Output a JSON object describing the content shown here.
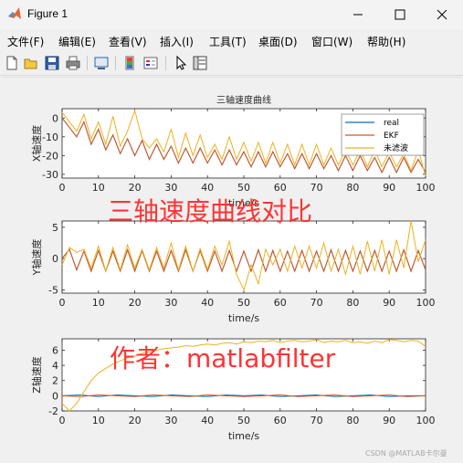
{
  "window": {
    "title": "Figure 1",
    "minimize_symbol": "—",
    "maximize_symbol": "☐",
    "close_symbol": "✕"
  },
  "menu": [
    "文件(F)",
    "编辑(E)",
    "查看(V)",
    "插入(I)",
    "工具(T)",
    "桌面(D)",
    "窗口(W)",
    "帮助(H)"
  ],
  "toolbar": {
    "icons": [
      "new-file-icon",
      "open-folder-icon",
      "save-icon",
      "print-icon",
      "link-figure-icon",
      "colorbar-icon",
      "legend-icon",
      "pointer-icon",
      "property-inspector-icon"
    ]
  },
  "overlays": {
    "comparison_caption": "三轴速度曲线对比",
    "author_caption": "作者：matlabfilter",
    "color": "#ff3333",
    "watermark": "CSDN @MATLAB卡尔曼"
  },
  "chart_data": [
    {
      "type": "line",
      "title": "三轴速度曲线",
      "xlabel": "time/s",
      "ylabel": "X轴速度",
      "xlim": [
        0,
        100
      ],
      "ylim": [
        -32,
        5
      ],
      "xticks": [
        "0",
        "10",
        "20",
        "30",
        "40",
        "50",
        "60",
        "70",
        "80",
        "90",
        "100"
      ],
      "yticks": [
        "0",
        "-10",
        "-20",
        "-30"
      ],
      "legend": {
        "placement": "top-right",
        "entries": [
          "real",
          "EKF",
          "未滤波"
        ]
      },
      "series": [
        {
          "name": "real",
          "color": "#0072bd",
          "x": [
            0,
            2,
            4,
            6,
            8,
            10,
            12,
            14,
            16,
            18,
            20,
            22,
            24,
            26,
            28,
            30,
            32,
            34,
            36,
            38,
            40,
            42,
            44,
            46,
            48,
            50,
            52,
            54,
            56,
            58,
            60,
            62,
            64,
            66,
            68,
            70,
            72,
            74,
            76,
            78,
            80,
            82,
            84,
            86,
            88,
            90,
            92,
            94,
            96,
            98,
            100
          ],
          "y": [
            0,
            -5,
            -10,
            -2,
            -14,
            -6,
            -17,
            -9,
            -19,
            -11,
            -20,
            -12,
            -22,
            -14,
            -22,
            -15,
            -24,
            -16,
            -24,
            -16,
            -24,
            -17,
            -25,
            -17,
            -25,
            -18,
            -26,
            -18,
            -26,
            -18,
            -26,
            -19,
            -27,
            -19,
            -27,
            -19,
            -27,
            -20,
            -28,
            -20,
            -28,
            -20,
            -28,
            -21,
            -29,
            -21,
            -29,
            -21,
            -29,
            -22,
            -29
          ]
        },
        {
          "name": "EKF",
          "color": "#d95319",
          "x": [
            0,
            2,
            4,
            6,
            8,
            10,
            12,
            14,
            16,
            18,
            20,
            22,
            24,
            26,
            28,
            30,
            32,
            34,
            36,
            38,
            40,
            42,
            44,
            46,
            48,
            50,
            52,
            54,
            56,
            58,
            60,
            62,
            64,
            66,
            68,
            70,
            72,
            74,
            76,
            78,
            80,
            82,
            84,
            86,
            88,
            90,
            92,
            94,
            96,
            98,
            100
          ],
          "y": [
            0,
            -5,
            -10,
            -2,
            -14,
            -6,
            -17,
            -9,
            -19,
            -11,
            -20,
            -12,
            -22,
            -14,
            -22,
            -15,
            -24,
            -16,
            -24,
            -16,
            -24,
            -17,
            -25,
            -17,
            -25,
            -18,
            -26,
            -18,
            -26,
            -18,
            -26,
            -19,
            -27,
            -19,
            -27,
            -19,
            -27,
            -20,
            -28,
            -20,
            -28,
            -20,
            -28,
            -21,
            -29,
            -21,
            -29,
            -21,
            -29,
            -22,
            -29
          ]
        },
        {
          "name": "未滤波",
          "color": "#edb120",
          "x": [
            0,
            2,
            4,
            6,
            8,
            10,
            12,
            14,
            16,
            18,
            20,
            22,
            24,
            26,
            28,
            30,
            32,
            34,
            36,
            38,
            40,
            42,
            44,
            46,
            48,
            50,
            52,
            54,
            56,
            58,
            60,
            62,
            64,
            66,
            68,
            70,
            72,
            74,
            76,
            78,
            80,
            82,
            84,
            86,
            88,
            90,
            92,
            94,
            96,
            98,
            100
          ],
          "y": [
            3,
            -2,
            -7,
            2,
            -11,
            -2,
            -14,
            1,
            -15,
            -7,
            4,
            -11,
            -16,
            -11,
            -18,
            -6,
            -21,
            -8,
            -20,
            -9,
            -21,
            -14,
            -22,
            -10,
            -22,
            -13,
            -23,
            -13,
            -24,
            -13,
            -24,
            -14,
            -25,
            -14,
            -25,
            -14,
            -25,
            -16,
            -25,
            -17,
            -25,
            -17,
            -26,
            -17,
            -26,
            -18,
            -26,
            -19,
            -28,
            -17,
            -31
          ]
        }
      ]
    },
    {
      "type": "line",
      "title": "",
      "xlabel": "time/s",
      "ylabel": "Y轴速度",
      "xlim": [
        0,
        100
      ],
      "ylim": [
        -5.5,
        6
      ],
      "xticks": [
        "0",
        "10",
        "20",
        "30",
        "40",
        "50",
        "60",
        "70",
        "80",
        "90",
        "100"
      ],
      "yticks": [
        "5",
        "0",
        "-5"
      ],
      "series": [
        {
          "name": "real",
          "color": "#0072bd",
          "x": [
            0,
            2,
            4,
            6,
            8,
            10,
            12,
            14,
            16,
            18,
            20,
            22,
            24,
            26,
            28,
            30,
            32,
            34,
            36,
            38,
            40,
            42,
            44,
            46,
            48,
            50,
            52,
            54,
            56,
            58,
            60,
            62,
            64,
            66,
            68,
            70,
            72,
            74,
            76,
            78,
            80,
            82,
            84,
            86,
            88,
            90,
            92,
            94,
            96,
            98,
            100
          ],
          "y": [
            0,
            1.5,
            -1.8,
            1.2,
            -2,
            1.3,
            -2,
            1.2,
            -2,
            1.4,
            -2,
            1.3,
            -2,
            1.2,
            -2,
            1.3,
            -2,
            1.4,
            -2,
            1.3,
            -2,
            1.2,
            -2,
            1.3,
            -2,
            1.2,
            -2,
            1.4,
            -2,
            1.3,
            -2,
            1.2,
            -2,
            1.3,
            -2,
            1.2,
            -2,
            1.4,
            -2,
            1.3,
            -2,
            1.2,
            -2,
            1.3,
            -2,
            1.2,
            -2,
            1.4,
            -2,
            1.3,
            -1.8
          ]
        },
        {
          "name": "EKF",
          "color": "#d95319",
          "x": [
            0,
            2,
            4,
            6,
            8,
            10,
            12,
            14,
            16,
            18,
            20,
            22,
            24,
            26,
            28,
            30,
            32,
            34,
            36,
            38,
            40,
            42,
            44,
            46,
            48,
            50,
            52,
            54,
            56,
            58,
            60,
            62,
            64,
            66,
            68,
            70,
            72,
            74,
            76,
            78,
            80,
            82,
            84,
            86,
            88,
            90,
            92,
            94,
            96,
            98,
            100
          ],
          "y": [
            0,
            1.5,
            -1.8,
            1.2,
            -2,
            1.3,
            -2,
            1.2,
            -2,
            1.4,
            -2,
            1.3,
            -2,
            1.2,
            -2,
            1.3,
            -2,
            1.4,
            -2,
            1.3,
            -2,
            1.2,
            -2,
            1.3,
            -2,
            1.2,
            -2,
            1.4,
            -2,
            1.3,
            -2,
            1.2,
            -2,
            1.3,
            -2,
            1.2,
            -2,
            1.4,
            -2,
            1.3,
            -2,
            1.2,
            -2,
            1.3,
            -2,
            1.2,
            -2,
            1.4,
            -2,
            1.3,
            -1.8
          ]
        },
        {
          "name": "未滤波",
          "color": "#edb120",
          "x": [
            0,
            2,
            4,
            6,
            8,
            10,
            12,
            14,
            16,
            18,
            20,
            22,
            24,
            26,
            28,
            30,
            32,
            34,
            36,
            38,
            40,
            42,
            44,
            46,
            48,
            50,
            52,
            54,
            56,
            58,
            60,
            62,
            64,
            66,
            68,
            70,
            72,
            74,
            76,
            78,
            80,
            82,
            84,
            86,
            88,
            90,
            92,
            94,
            96,
            98,
            100
          ],
          "y": [
            -1,
            1.8,
            1,
            1.5,
            -1.5,
            2,
            -2,
            1.8,
            -1.8,
            2.2,
            -1.5,
            1.5,
            -1.8,
            1.8,
            -1.5,
            2.5,
            -1.8,
            2,
            -2,
            1.6,
            -1.7,
            2,
            -1,
            2.8,
            -2.5,
            -5,
            -1,
            -4,
            1.5,
            -1,
            1.5,
            -2,
            2,
            -1.5,
            2,
            -1.5,
            2.5,
            -2,
            1.5,
            -2.5,
            2,
            -2.5,
            2.8,
            -2,
            3,
            -2.5,
            3,
            -1.5,
            6,
            -0.5,
            3
          ]
        }
      ]
    },
    {
      "type": "line",
      "title": "",
      "xlabel": "time/s",
      "ylabel": "Z轴速度",
      "xlim": [
        0,
        100
      ],
      "ylim": [
        -2,
        7.5
      ],
      "xticks": [
        "0",
        "10",
        "20",
        "30",
        "40",
        "50",
        "60",
        "70",
        "80",
        "90",
        "100"
      ],
      "yticks": [
        "6",
        "4",
        "2",
        "0",
        "-2"
      ],
      "series": [
        {
          "name": "real",
          "color": "#0072bd",
          "x": [
            0,
            5,
            10,
            15,
            20,
            25,
            30,
            35,
            40,
            45,
            50,
            55,
            60,
            65,
            70,
            75,
            80,
            85,
            90,
            95,
            100
          ],
          "y": [
            0,
            0.1,
            -0.1,
            0.1,
            0,
            -0.1,
            0.1,
            0,
            -0.1,
            0.1,
            0,
            0.1,
            -0.1,
            0,
            0.1,
            -0.1,
            0,
            0.1,
            -0.1,
            0,
            0
          ]
        },
        {
          "name": "EKF",
          "color": "#d95319",
          "x": [
            0,
            5,
            10,
            15,
            20,
            25,
            30,
            35,
            40,
            45,
            50,
            55,
            60,
            65,
            70,
            75,
            80,
            85,
            90,
            95,
            100
          ],
          "y": [
            0,
            -0.1,
            0.1,
            0,
            -0.1,
            0.1,
            0,
            -0.1,
            0.1,
            0,
            -0.1,
            0,
            0.1,
            -0.1,
            0,
            0.1,
            -0.1,
            0,
            0.1,
            -0.1,
            0
          ]
        },
        {
          "name": "未滤波",
          "color": "#edb120",
          "x": [
            0,
            2,
            4,
            6,
            8,
            10,
            12,
            14,
            16,
            18,
            20,
            22,
            24,
            26,
            28,
            30,
            32,
            34,
            36,
            38,
            40,
            42,
            44,
            46,
            48,
            50,
            52,
            54,
            56,
            58,
            60,
            62,
            64,
            66,
            68,
            70,
            72,
            74,
            76,
            78,
            80,
            82,
            84,
            86,
            88,
            90,
            92,
            94,
            96,
            98,
            100
          ],
          "y": [
            -1,
            -2,
            -1,
            0.5,
            2,
            3,
            3.6,
            4.2,
            4.6,
            5,
            5.2,
            5.6,
            5.8,
            6,
            6.2,
            6.3,
            6.4,
            6.6,
            6.5,
            6.7,
            6.8,
            6.7,
            6.9,
            7,
            6.8,
            7.1,
            7,
            7.2,
            7.1,
            7.3,
            7,
            7.2,
            7.3,
            7.1,
            7.2,
            7.4,
            7,
            7.2,
            7.1,
            7.3,
            7,
            7.1,
            6.9,
            7.2,
            7,
            7.4,
            7.3,
            7.1,
            7.3,
            7.2,
            6.5
          ]
        }
      ]
    }
  ]
}
